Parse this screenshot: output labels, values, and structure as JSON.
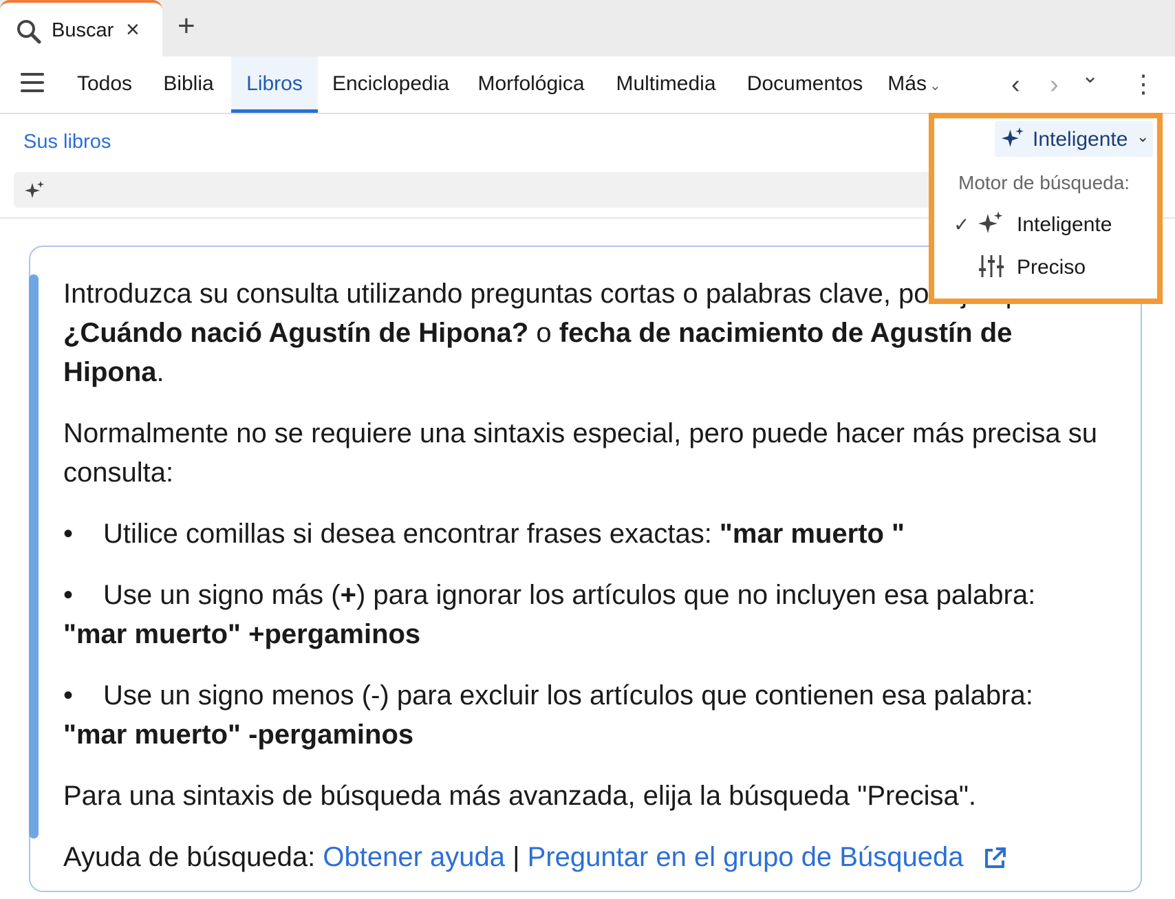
{
  "tab": {
    "title": "Buscar",
    "icon": "search-icon",
    "close_symbol": "×",
    "new_tab_symbol": "+"
  },
  "nav": {
    "tabs": [
      {
        "label": "Todos"
      },
      {
        "label": "Biblia"
      },
      {
        "label": "Libros"
      },
      {
        "label": "Enciclopedia"
      },
      {
        "label": "Morfológica"
      },
      {
        "label": "Multimedia"
      },
      {
        "label": "Documentos"
      },
      {
        "label": "Más"
      }
    ],
    "active_tab": "Libros",
    "back_symbol": "‹",
    "forward_symbol": "›",
    "history_symbol": "⌄",
    "more_symbol": "⋮"
  },
  "sub": {
    "your_books_link": "Sus libros"
  },
  "engine": {
    "current": "Inteligente",
    "menu_header": "Motor de búsqueda:",
    "options": [
      {
        "label": "Inteligente",
        "icon": "sparkle-icon",
        "checked": true
      },
      {
        "label": "Preciso",
        "icon": "sliders-icon",
        "checked": false
      }
    ]
  },
  "help": {
    "intro_1": "Introduzca su consulta utilizando preguntas cortas o palabras clave, por ejemplo",
    "example_1": "¿Cuándo nació Agustín de Hipona?",
    "or": " o ",
    "example_2": "fecha de nacimiento de Agustín de Hipona",
    "period": ".",
    "syntax_intro": "Normalmente no se requiere una sintaxis especial, pero puede hacer más precisa su consulta:",
    "bullet_1_text": "Utilice comillas si desea encontrar frases exactas: ",
    "bullet_1_example": "\"mar muerto \"",
    "bullet_2_text": "Use un signo más (",
    "bullet_2_sym": "+",
    "bullet_2_text_b": ") para ignorar los artículos que no incluyen esa palabra:",
    "bullet_2_example": "\"mar muerto\" +pergaminos",
    "bullet_3_text": "Use un signo menos (-) para excluir los artículos que contienen esa palabra:",
    "bullet_3_example": "\"mar muerto\" -pergaminos",
    "advanced": "Para una sintaxis de búsqueda más avanzada, elija la búsqueda \"Precisa\".",
    "help_label": "Ayuda de búsqueda: ",
    "help_link_1": "Obtener ayuda",
    "separator": " | ",
    "help_link_2": "Preguntar en el grupo de Búsqueda"
  },
  "colors": {
    "accent_blue": "#2c6fd6",
    "highlight_orange": "#f39a35",
    "tab_orange": "#f07c3a"
  }
}
